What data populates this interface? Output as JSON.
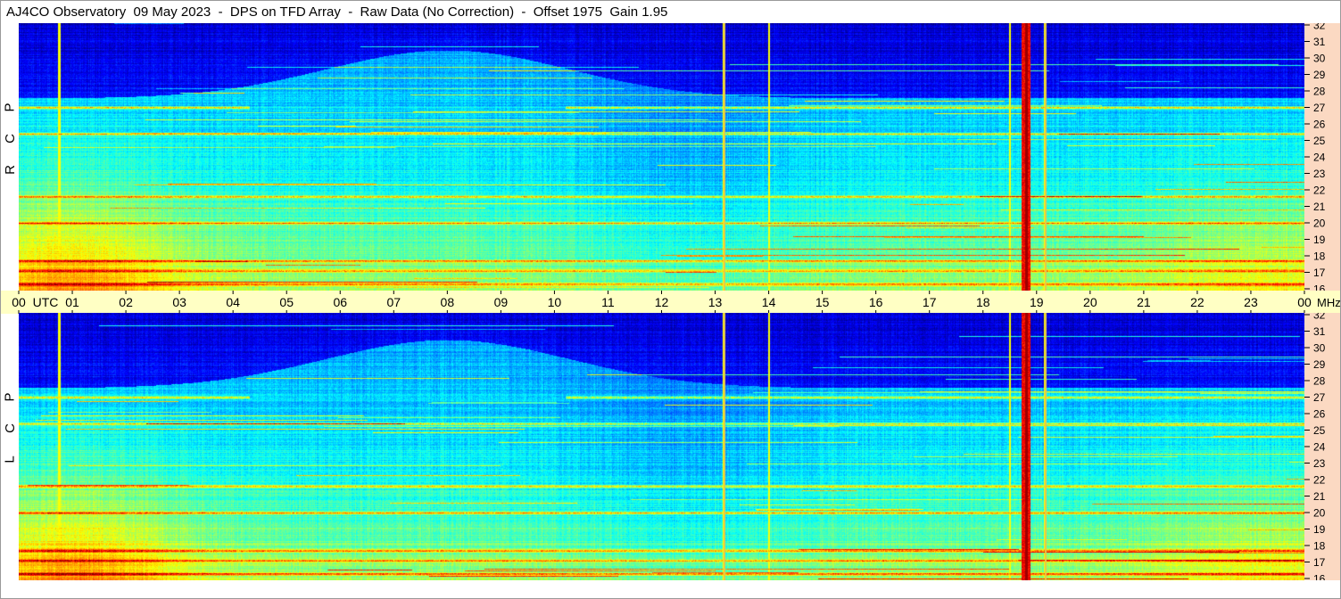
{
  "title": "AJ4CO Observatory  09 May 2023  -  DPS on TFD Array  -  Raw Data (No Correction)  -  Offset 1975  Gain 1.95",
  "colors": {
    "frame": "#9a9a9a",
    "time_band": "#ffffc4",
    "freq_band": "#fbd9c2",
    "marker_line": "#e6c84a"
  },
  "panels": [
    {
      "label_letters": [
        "P",
        "C",
        "R"
      ]
    },
    {
      "label_letters": [
        "P",
        "C",
        "L"
      ]
    }
  ],
  "time_axis": {
    "unit_label": "UTC",
    "ticks": [
      "00",
      "01",
      "02",
      "03",
      "04",
      "05",
      "06",
      "07",
      "08",
      "09",
      "10",
      "11",
      "12",
      "13",
      "14",
      "15",
      "16",
      "17",
      "18",
      "19",
      "20",
      "21",
      "22",
      "23",
      "00"
    ],
    "freq_unit": "MHz"
  },
  "chart_data": [
    {
      "type": "heatmap",
      "series_label": "RCP",
      "x": {
        "label": "UTC",
        "range": [
          0,
          24
        ],
        "ticks": [
          0,
          1,
          2,
          3,
          4,
          5,
          6,
          7,
          8,
          9,
          10,
          11,
          12,
          13,
          14,
          15,
          16,
          17,
          18,
          19,
          20,
          21,
          22,
          23,
          24
        ],
        "tick_labels": [
          "00",
          "01",
          "02",
          "03",
          "04",
          "05",
          "06",
          "07",
          "08",
          "09",
          "10",
          "11",
          "12",
          "13",
          "14",
          "15",
          "16",
          "17",
          "18",
          "19",
          "20",
          "21",
          "22",
          "23",
          "00"
        ]
      },
      "y": {
        "label": "MHz",
        "range": [
          16,
          32
        ],
        "ticks": [
          16,
          17,
          18,
          19,
          20,
          21,
          22,
          23,
          24,
          25,
          26,
          27,
          28,
          29,
          30,
          31,
          32
        ]
      },
      "interference_bands_mhz": [
        27.0,
        17.7,
        17.1,
        20.0,
        21.6,
        25.4,
        16.3
      ],
      "vertical_events_utc": [
        0.75,
        13.15,
        14.0,
        18.5,
        18.8,
        19.15
      ]
    },
    {
      "type": "heatmap",
      "series_label": "LCP",
      "x": {
        "label": "UTC",
        "range": [
          0,
          24
        ],
        "ticks": [
          0,
          1,
          2,
          3,
          4,
          5,
          6,
          7,
          8,
          9,
          10,
          11,
          12,
          13,
          14,
          15,
          16,
          17,
          18,
          19,
          20,
          21,
          22,
          23,
          24
        ],
        "tick_labels": [
          "00",
          "01",
          "02",
          "03",
          "04",
          "05",
          "06",
          "07",
          "08",
          "09",
          "10",
          "11",
          "12",
          "13",
          "14",
          "15",
          "16",
          "17",
          "18",
          "19",
          "20",
          "21",
          "22",
          "23",
          "00"
        ]
      },
      "y": {
        "label": "MHz",
        "range": [
          16,
          32
        ],
        "ticks": [
          16,
          17,
          18,
          19,
          20,
          21,
          22,
          23,
          24,
          25,
          26,
          27,
          28,
          29,
          30,
          31,
          32
        ]
      },
      "interference_bands_mhz": [
        27.0,
        17.7,
        17.1,
        20.0,
        21.6,
        25.4,
        16.3
      ],
      "vertical_events_utc": [
        0.75,
        13.15,
        14.0,
        18.5,
        18.8,
        19.15
      ]
    }
  ]
}
